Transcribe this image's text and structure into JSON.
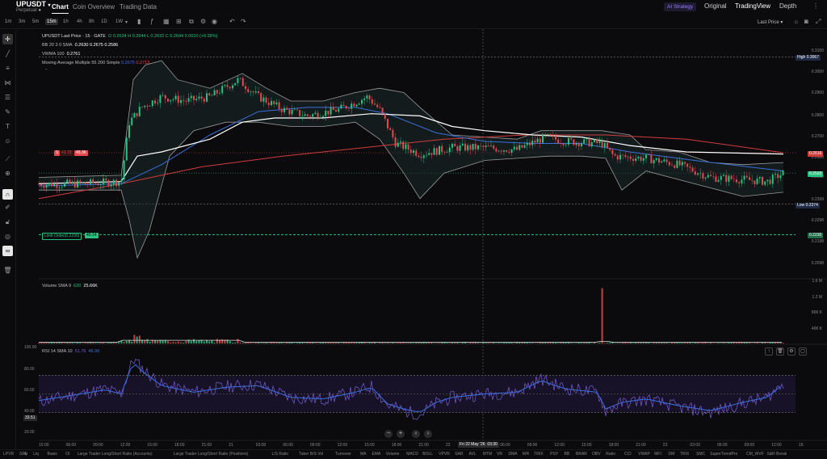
{
  "header": {
    "symbol": "UPUSDT",
    "symbol_caret": "▾",
    "subtitle": "Perpetual",
    "tabs": [
      {
        "label": "Chart",
        "active": true
      },
      {
        "label": "Coin Overview",
        "active": false
      },
      {
        "label": "Trading Data",
        "active": false
      }
    ],
    "right": {
      "ai_strategy": "AI Strategy",
      "original": "Original",
      "tradingview": "TradingView",
      "depth": "Depth"
    }
  },
  "toolbar": {
    "timeframes": [
      "1m",
      "3m",
      "5m",
      "15m",
      "1h",
      "4h",
      "8h",
      "1D",
      "1W"
    ],
    "active_timeframe": "15m",
    "timeframe_caret": "▾",
    "price_mode": "Last Price ▾"
  },
  "legend": {
    "main": {
      "title": "UPUSDT Last Price · 15 · GATE",
      "values": "O 0.2634  H 0.2644  L 0.2632  C 0.2644  0.0010 (+0.38%)"
    },
    "bb": {
      "label": "BB 20 3 0 SMA",
      "values": "0.2630  0.2675  0.2586"
    },
    "vwma": {
      "label": "VWMA 100",
      "value": "0.2761"
    },
    "ma": {
      "label": "Moving Average Multiple 55 200 Simple",
      "v1": "0.2675",
      "v2": "0.2713"
    },
    "volume": {
      "label": "Volume SMA 9",
      "v1": "620",
      "v2": "25.66K"
    },
    "rsi": {
      "label": "RSI 14 SMA 10",
      "v1": "51.76",
      "v2": "46.96"
    }
  },
  "price_axis": {
    "labels": [
      "0.3100",
      "0.3000",
      "0.2900",
      "0.2800",
      "0.2700",
      "0.2600",
      "0.2500",
      "0.2399",
      "0.2298",
      "0.2198",
      "0.2098"
    ],
    "high_label": "High",
    "high_value": "0.3067",
    "low_label": "Low",
    "low_value": "0.2374",
    "current_tag": "0.2616",
    "last_tag": "0.2520",
    "order_tag": "0.2230"
  },
  "position": {
    "side_label": "S",
    "qty": "+1.72",
    "pnl": "45.36"
  },
  "order": {
    "label": "Limit Order(0.2230)",
    "value": "40.14"
  },
  "volume_axis": [
    "1.6 M",
    "1.2 M",
    "800 K",
    "400 K"
  ],
  "rsi_axis": [
    "100.00",
    "80.00",
    "60.00",
    "40.00",
    "20.00"
  ],
  "rsi_current": "33.51",
  "time_axis": [
    "15:00",
    "06:00",
    "09:00",
    "12:00",
    "15:00",
    "18:00",
    "21:00",
    "21",
    "03:00",
    "06:00",
    "09:00",
    "12:00",
    "15:00",
    "18:00",
    "21:00",
    "22",
    "03:00",
    "06:00",
    "09:00",
    "12:00",
    "15:00",
    "18:00",
    "21:00",
    "23",
    "03:00",
    "06:00",
    "09:00",
    "12:00",
    "15:"
  ],
  "crosshair_time": "Fri 22 May '26",
  "crosshair_clock": "03:30",
  "indicators": [
    "LPVR",
    "SRL",
    "Liq",
    "Basis",
    "OI",
    "Large Trader Long/Short Ratio (Accounts)",
    "Large Trader Long/Short Ratio (Positions)",
    "L/S Ratio",
    "Taker B/S Vol",
    "Turnover",
    "MA",
    "EMA",
    "Volume",
    "MACD",
    "BOLL",
    "VPVR",
    "SAR",
    "AVL",
    "MTM",
    "VR",
    "DMA",
    "WR",
    "TRIX",
    "PSY",
    "BB",
    "BRAR",
    "OBV",
    "Ratio",
    "CCI",
    "VWAP",
    "MFI",
    "DM",
    "TRIX",
    "SMC",
    "SuperTrendPro",
    "CM_WVF",
    "S&R Break"
  ],
  "colors": {
    "up": "#26c281",
    "down": "#e5484d",
    "bb": "#9a9a9a",
    "vwma": "#ffffff",
    "ma55": "#3b6fdc",
    "ma200": "#d33b3b",
    "rsi": "#7a5cd6",
    "rsi_sma": "#3b6fdc"
  },
  "icons": [
    "cursor-icon",
    "trendline-icon",
    "fib-icon",
    "pattern-icon",
    "measure-icon",
    "brush-icon",
    "text-icon",
    "emoji-icon",
    "ruler-icon",
    "zoom-icon",
    "magnet-icon",
    "lock-icon",
    "eye-icon",
    "link-icon",
    "trash-icon"
  ]
}
